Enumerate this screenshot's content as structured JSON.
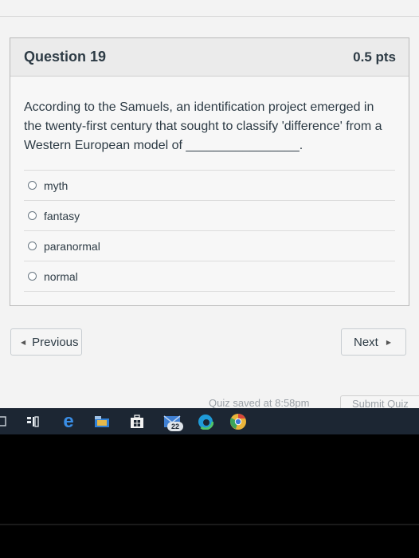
{
  "question": {
    "title": "Question 19",
    "points": "0.5 pts",
    "text": "According to the Samuels, an identification project emerged in the twenty-first century that sought to classify 'difference' from a Western European model of ________________."
  },
  "answers": [
    {
      "label": "myth"
    },
    {
      "label": "fantasy"
    },
    {
      "label": "paranormal"
    },
    {
      "label": "normal"
    }
  ],
  "nav": {
    "prev_label": "Previous",
    "next_label": "Next"
  },
  "footer": {
    "quiz_saved": "Quiz saved at 8:58pm",
    "submit_label": "Submit Quiz"
  },
  "taskbar": {
    "badge_count": "22"
  }
}
